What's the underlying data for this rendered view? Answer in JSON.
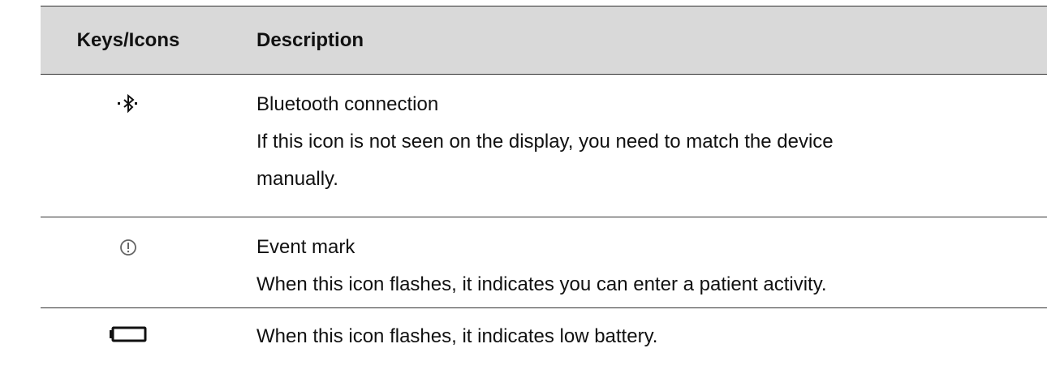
{
  "table": {
    "headers": {
      "keys_icons": "Keys/Icons",
      "description": "Description"
    },
    "rows": [
      {
        "icon": "bluetooth-icon",
        "lines": [
          "Bluetooth connection",
          "If this icon is not seen on the display, you need to match the device",
          "manually."
        ]
      },
      {
        "icon": "event-mark-icon",
        "lines": [
          "Event mark",
          "When this icon flashes, it indicates you can enter a patient activity."
        ]
      },
      {
        "icon": "battery-icon",
        "lines": [
          "When this icon flashes, it indicates low battery."
        ]
      }
    ]
  }
}
